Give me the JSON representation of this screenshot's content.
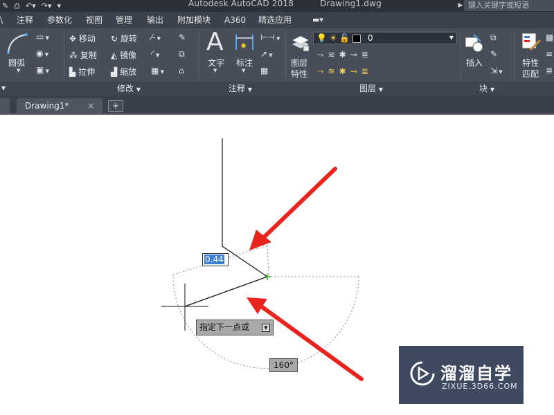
{
  "titlebar": {
    "app": "Autodesk AutoCAD 2018",
    "document": "Drawing1.dwg",
    "search_placeholder": "键入关键字或短语"
  },
  "menu": {
    "items": [
      "注释",
      "参数化",
      "视图",
      "管理",
      "输出",
      "附加模块",
      "A360",
      "精选应用"
    ]
  },
  "ribbon": {
    "draw": {
      "arc": "圆弧"
    },
    "modify": {
      "move": "移动",
      "rotate": "旋转",
      "copy": "复制",
      "mirror": "镜像",
      "stretch": "拉伸",
      "scale": "缩放",
      "panel_title": "修改"
    },
    "annotation": {
      "text": "文字",
      "dimension": "标注",
      "panel_title": "注释"
    },
    "layers": {
      "properties_line1": "图层",
      "properties_line2": "特性",
      "current_layer": "0",
      "panel_title": "图层"
    },
    "block": {
      "insert": "插入",
      "panel_title": "块"
    },
    "properties": {
      "match_line1": "特性",
      "match_line2": "匹配"
    }
  },
  "filetabs": {
    "active": "Drawing1*",
    "close_glyph": "×",
    "new_glyph": "+"
  },
  "drawing": {
    "dynamic_input_value": "0.44",
    "prompt": "指定下一点或",
    "angle": "160°"
  },
  "watermark": {
    "title": "溜溜自学",
    "url": "ZIXUE.3D66.COM"
  },
  "colors": {
    "arrow": "#e8241c",
    "snap": "#22b022",
    "accent": "#3d7ed7"
  }
}
